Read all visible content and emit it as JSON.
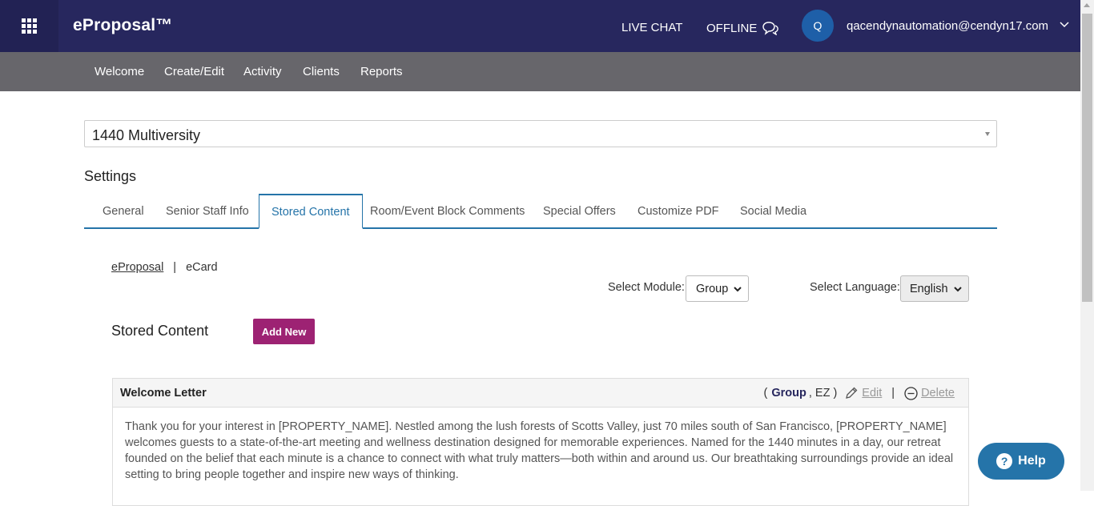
{
  "header": {
    "brand": "eProposal™",
    "live_chat": "LIVE CHAT",
    "offline": "OFFLINE",
    "avatar_initial": "Q",
    "user_email": "qacendynautomation@cendyn17.com"
  },
  "nav": {
    "items": [
      "Welcome",
      "Create/Edit",
      "Activity",
      "Clients",
      "Reports"
    ]
  },
  "property_select": {
    "value": "1440 Multiversity"
  },
  "settings": {
    "title": "Settings",
    "tabs": [
      "General",
      "Senior Staff Info",
      "Stored Content",
      "Room/Event Block Comments",
      "Special Offers",
      "Customize PDF",
      "Social Media"
    ],
    "active_tab": "Stored Content"
  },
  "sub_links": {
    "eproposal": "eProposal",
    "separator": "|",
    "ecard": "eCard"
  },
  "filters": {
    "module_label": "Select Module:",
    "module_value": "Group",
    "language_label": "Select Language:",
    "language_value": "English"
  },
  "stored_content": {
    "title": "Stored Content",
    "add_new": "Add New"
  },
  "item": {
    "title": "Welcome Letter",
    "open_paren": "(",
    "module": "Group",
    "type": ", EZ )",
    "edit": "Edit",
    "pipe": "|",
    "delete": "Delete",
    "body": "Thank you for your interest in [PROPERTY_NAME]. Nestled among the lush forests of Scotts Valley, just 70 miles south of San Francisco, [PROPERTY_NAME] welcomes guests to a state-of-the-art meeting and wellness destination designed for memorable experiences. Named for the 1440 minutes in a day, our retreat founded on the belief that each minute is a chance to connect with what truly matters—both within and around us. Our breathtaking surroundings provide an ideal setting to bring people together and inspire new ways of thinking."
  },
  "help": {
    "label": "Help"
  },
  "colors": {
    "header_bg": "#27275e",
    "nav_bg": "#67666b",
    "accent_blue": "#2574a9",
    "add_new_bg": "#9d2273"
  },
  "icons": [
    "apps-grid-icon",
    "chat-bubble-icon",
    "chevron-down-icon",
    "pencil-icon",
    "minus-circle-icon",
    "question-icon"
  ]
}
